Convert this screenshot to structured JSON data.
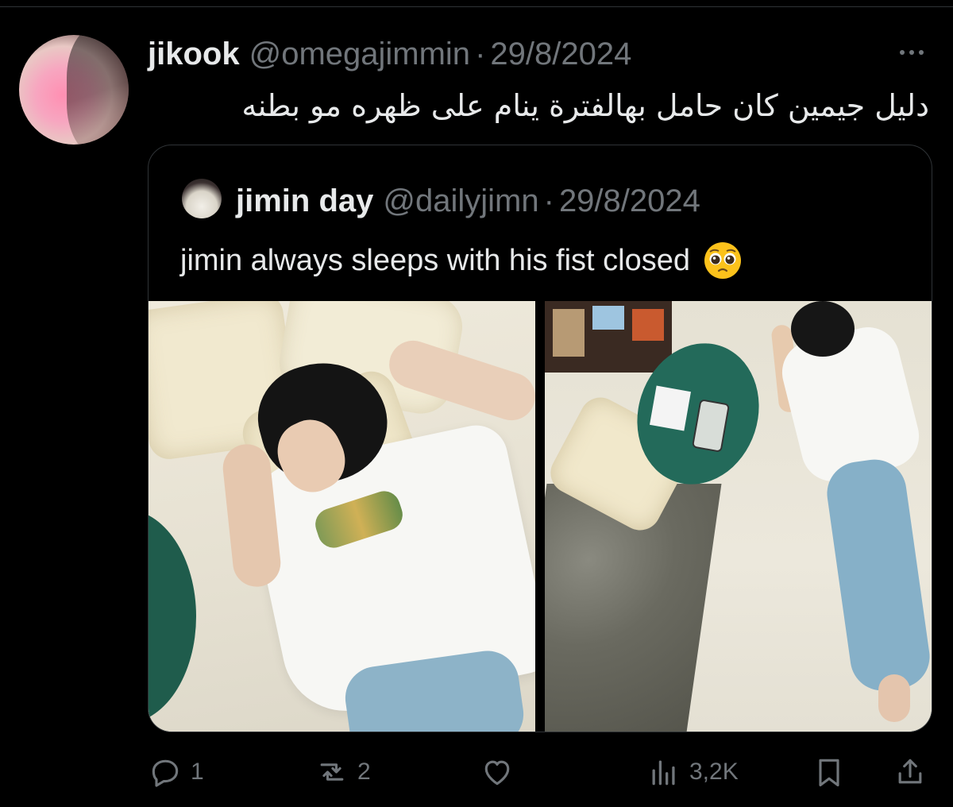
{
  "tweet": {
    "display_name": "jikook",
    "handle": "@omegajimmin",
    "separator": "·",
    "date": "29/8/2024",
    "text": "دليل جيمين كان حامل بهالفترة ينام على ظهره مو بطنه"
  },
  "quote": {
    "display_name": "jimin day",
    "handle": "@dailyjimn",
    "separator": "·",
    "date": "29/8/2024",
    "text": "jimin always sleeps with his fist closed",
    "emoji_icon": "pleading-face-icon",
    "photo_count": 2
  },
  "actions": {
    "reply_count": "1",
    "retweet_count": "2",
    "like_count": "",
    "views_count": "3,2K"
  },
  "colors": {
    "background": "#000000",
    "text_primary": "#e7e9ea",
    "text_secondary": "#71767b",
    "border": "#2f3336"
  }
}
